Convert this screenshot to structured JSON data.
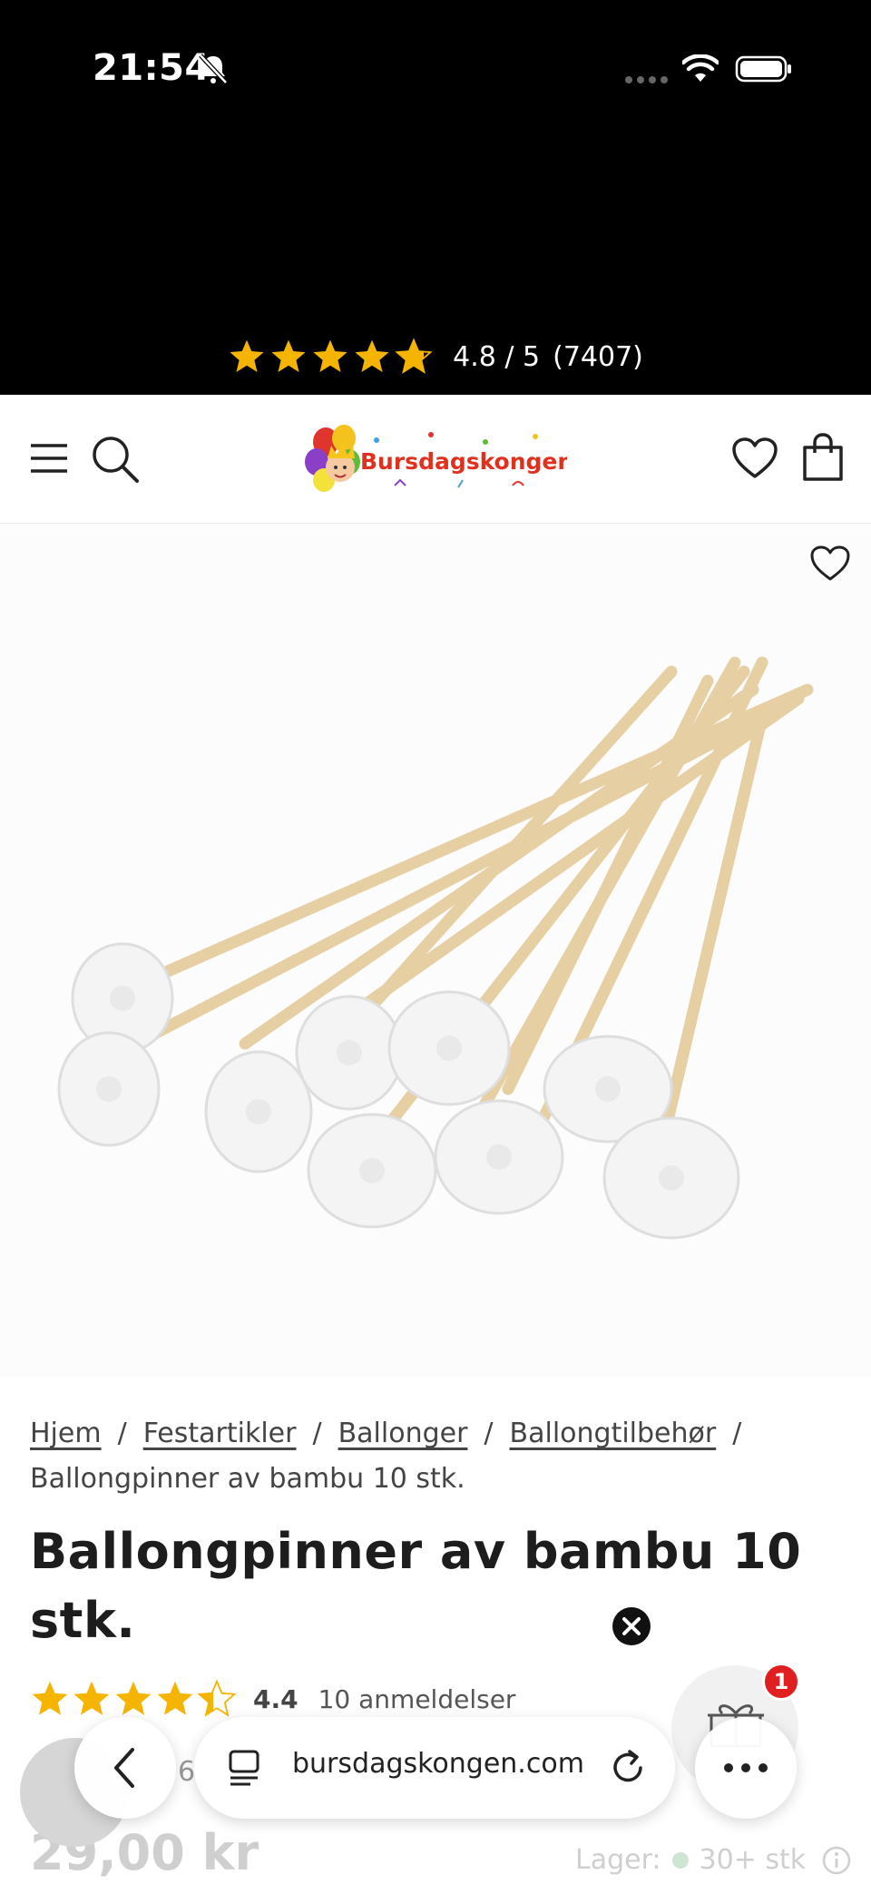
{
  "status_bar": {
    "time": "21:54"
  },
  "rating_banner": {
    "score": "4.8 / 5",
    "count": "(7407)",
    "rating": 4.8,
    "star_color": "#f5b400"
  },
  "header": {
    "logo_text": "Bursdagskongen.com"
  },
  "breadcrumb": {
    "items": [
      "Hjem",
      "Festartikler",
      "Ballonger",
      "Ballongtilbehør"
    ],
    "separator": "/",
    "current": "Ballongpinner av bambu 10 stk."
  },
  "product": {
    "title": "Ballongpinner av bambu 10 stk.",
    "rating": 4.4,
    "rating_text": "4.4",
    "reviews_text": "10 anmeldelser",
    "price": "29,00 kr",
    "stock_label": "Lager:",
    "stock_value": "30+ stk"
  },
  "floating": {
    "gift_badge": "1",
    "partial_text": "6"
  },
  "browser": {
    "url": "bursdagskongen.com"
  },
  "colors": {
    "accent_star": "#f5b400",
    "badge_red": "#e02020",
    "stock_dot": "#cfe5d4"
  }
}
